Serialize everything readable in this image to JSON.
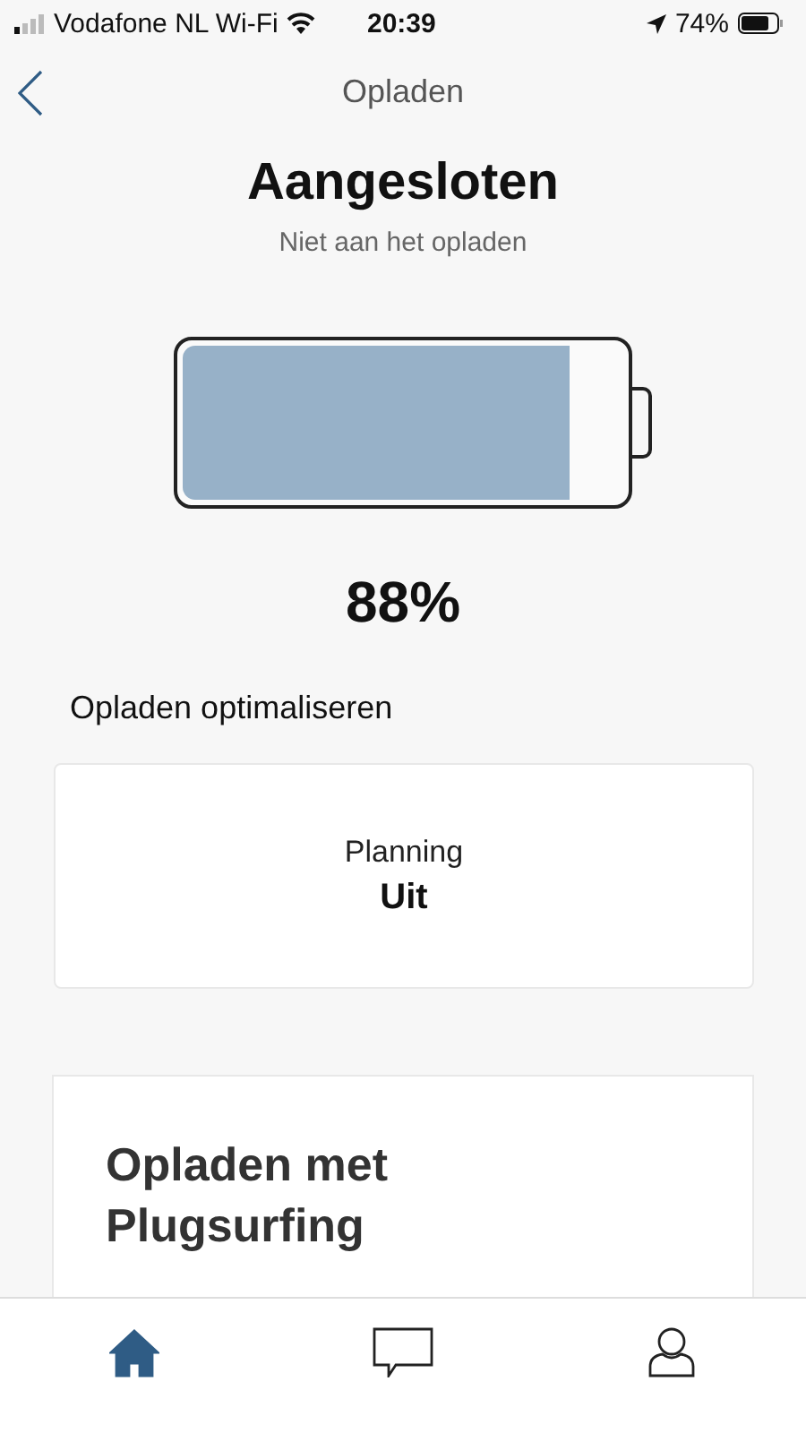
{
  "status_bar": {
    "carrier": "Vodafone NL Wi-Fi",
    "time": "20:39",
    "battery": "74%"
  },
  "nav": {
    "title": "Opladen"
  },
  "header": {
    "title": "Aangesloten",
    "subtitle": "Niet aan het opladen"
  },
  "battery": {
    "level": 0.88,
    "reading": "88%"
  },
  "section": {
    "title": "Opladen optimaliseren"
  },
  "planning_card": {
    "label": "Planning",
    "value": "Uit"
  },
  "promo_card": {
    "title": "Opladen met Plugsurfing"
  },
  "tab_bar": [
    {
      "kind": "home",
      "selected": true
    },
    {
      "kind": "chat",
      "selected": false
    },
    {
      "kind": "profile",
      "selected": false
    }
  ]
}
